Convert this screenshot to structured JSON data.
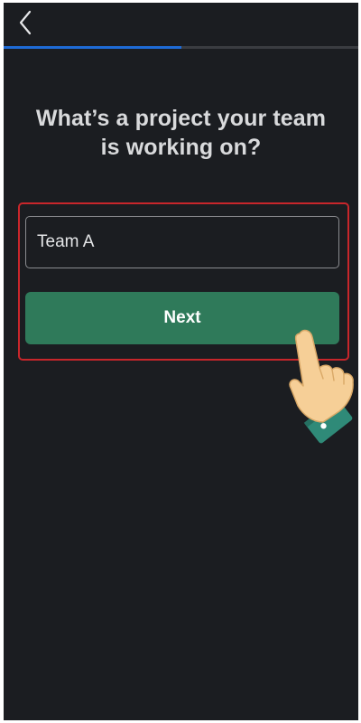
{
  "header": {
    "back_icon": "chevron-left-icon"
  },
  "progress": {
    "fraction": 0.5,
    "color": "#1e6bd6"
  },
  "question": {
    "text": "What’s a project your team is working on?"
  },
  "form": {
    "input_value": "Team A",
    "next_label": "Next"
  },
  "annotation": {
    "highlight_color": "#c8262b",
    "pointer_icon": "pointing-hand-icon"
  },
  "colors": {
    "background": "#1b1d21",
    "button": "#2f7a5a",
    "text": "#d9dadc"
  }
}
